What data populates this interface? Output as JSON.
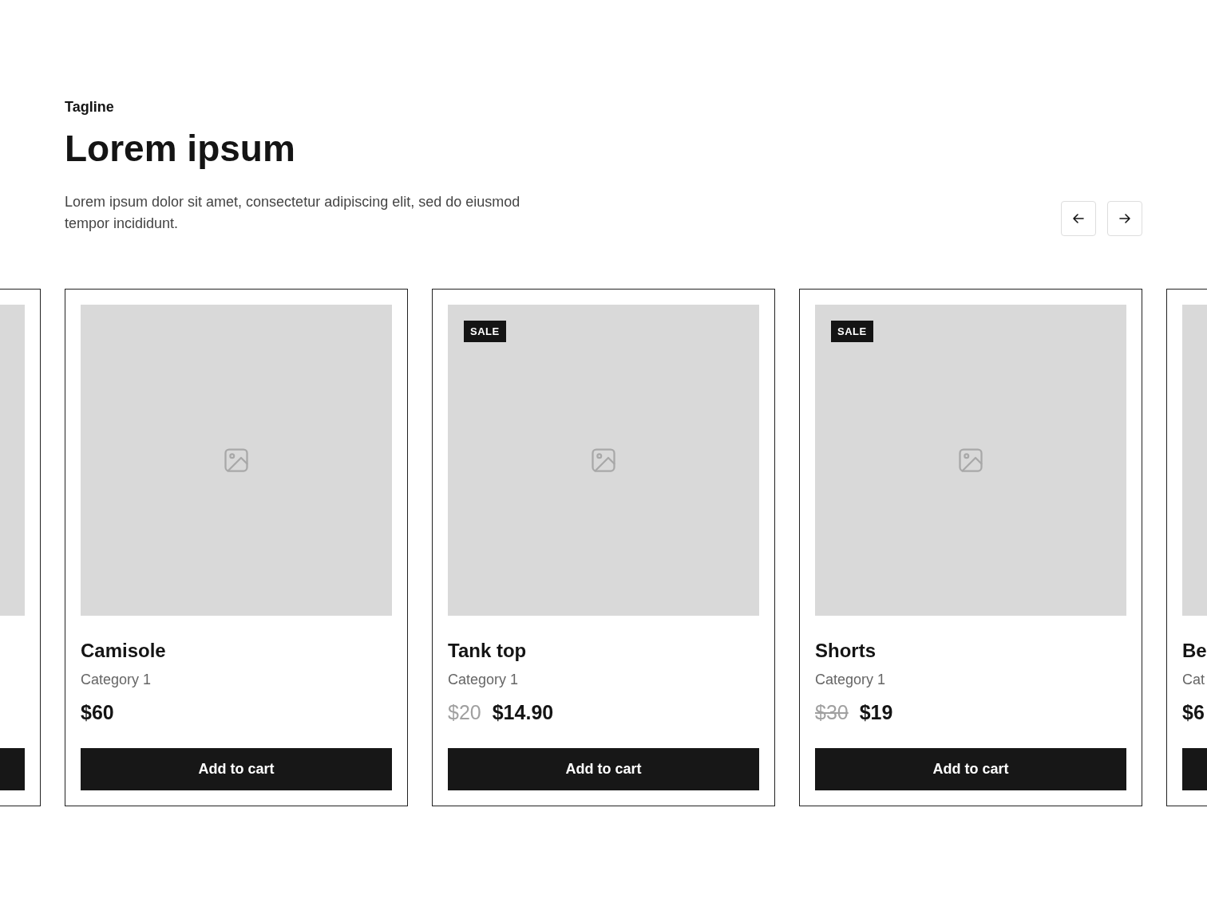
{
  "header": {
    "tagline": "Tagline",
    "title": "Lorem ipsum",
    "description": "Lorem ipsum dolor sit amet, consectetur adipiscing elit, sed do eiusmod tempor incididunt."
  },
  "carousel": {
    "cards": [
      {
        "kind": "clipped"
      },
      {
        "kind": "product",
        "name": "Camisole",
        "category": "Category 1",
        "price": "$60",
        "button": "Add to cart"
      },
      {
        "kind": "product",
        "name": "Tank top",
        "category": "Category 1",
        "old_price": "$20",
        "old_price_struck": false,
        "price": "$14.90",
        "badge": "SALE",
        "button": "Add to cart"
      },
      {
        "kind": "product",
        "name": "Shorts",
        "category": "Category 1",
        "old_price": "$30",
        "old_price_struck": true,
        "price": "$19",
        "badge": "SALE",
        "button": "Add to cart"
      },
      {
        "kind": "edge",
        "name": "Be",
        "category": "Cat",
        "price": "$6"
      }
    ]
  }
}
